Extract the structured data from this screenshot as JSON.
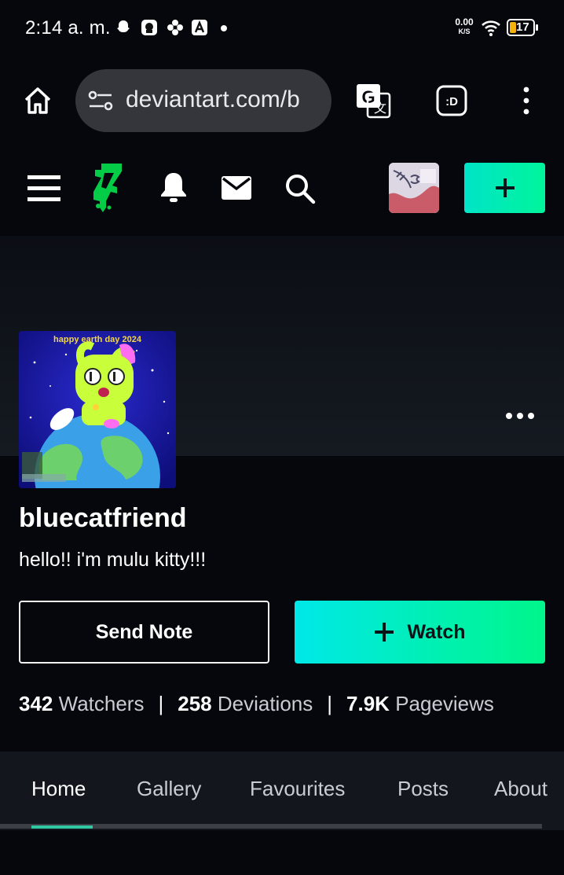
{
  "status_bar": {
    "time": "2:14 a. m.",
    "net_speed_value": "0.00",
    "net_speed_unit": "K/S",
    "battery": "17",
    "icons": [
      "snapchat-icon",
      "character-app-icon",
      "flower-app-icon",
      "text-app-icon",
      "wifi-icon",
      "battery-icon"
    ]
  },
  "browser": {
    "url": "deviantart.com/b",
    "icons": [
      "home-icon",
      "site-settings-icon",
      "translate-icon",
      "extension-icon",
      "more-vert-icon"
    ]
  },
  "da_nav": {
    "icons": [
      "menu-icon",
      "deviantart-logo",
      "bell-icon",
      "mail-icon",
      "search-icon",
      "plus-icon"
    ]
  },
  "profile": {
    "artwork_caption": "happy earth day 2024",
    "username": "bluecatfriend",
    "tagline": "hello!! i'm mulu kitty!!!",
    "send_note_label": "Send Note",
    "watch_label": "Watch",
    "stats": {
      "watchers_count": "342",
      "watchers_label": "Watchers",
      "deviations_count": "258",
      "deviations_label": "Deviations",
      "pageviews_count": "7.9K",
      "pageviews_label": "Pageviews",
      "separator": "|"
    }
  },
  "tabs": [
    {
      "label": "Home",
      "active": true
    },
    {
      "label": "Gallery"
    },
    {
      "label": "Favourites"
    },
    {
      "label": "Posts"
    },
    {
      "label": "About"
    }
  ],
  "colors": {
    "background": "#06070d",
    "accent_start": "#00e8e8",
    "accent_end": "#00f68a",
    "tab_indicator": "#2fc8a0"
  }
}
